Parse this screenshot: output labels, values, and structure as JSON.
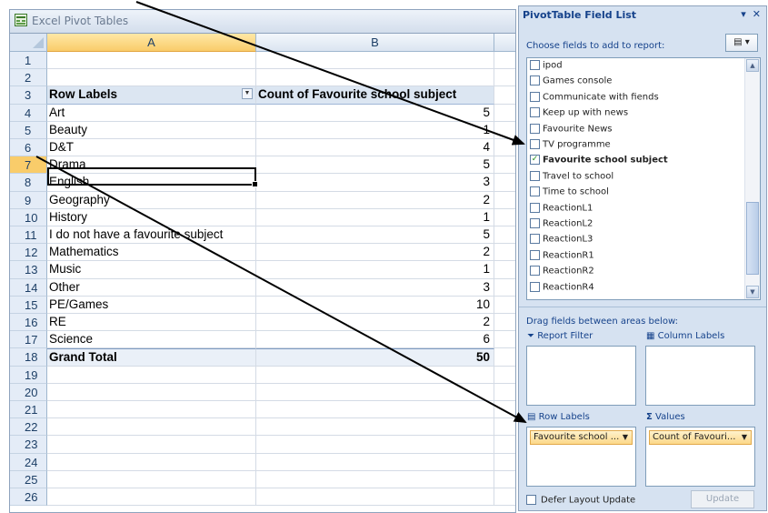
{
  "window": {
    "title": "Excel Pivot Tables",
    "icon": "excel-icon"
  },
  "columns": [
    "A",
    "B"
  ],
  "row_numbers": [
    "1",
    "2",
    "3",
    "4",
    "5",
    "6",
    "7",
    "8",
    "9",
    "10",
    "11",
    "12",
    "13",
    "14",
    "15",
    "16",
    "17",
    "18",
    "19",
    "20",
    "21",
    "22",
    "23",
    "24",
    "25",
    "26"
  ],
  "pivot": {
    "row_labels_header": "Row Labels",
    "values_header": "Count of Favourite school subject",
    "rows": [
      {
        "label": "Art",
        "count": "5"
      },
      {
        "label": "Beauty",
        "count": "1"
      },
      {
        "label": "D&T",
        "count": "4"
      },
      {
        "label": "Drama",
        "count": "5"
      },
      {
        "label": "English",
        "count": "3"
      },
      {
        "label": "Geography",
        "count": "2"
      },
      {
        "label": "History",
        "count": "1"
      },
      {
        "label": "I do not have a favourite subject",
        "count": "5"
      },
      {
        "label": "Mathematics",
        "count": "2"
      },
      {
        "label": "Music",
        "count": "1"
      },
      {
        "label": "Other",
        "count": "3"
      },
      {
        "label": "PE/Games",
        "count": "10"
      },
      {
        "label": "RE",
        "count": "2"
      },
      {
        "label": "Science",
        "count": "6"
      }
    ],
    "grand_total_label": "Grand Total",
    "grand_total_value": "50"
  },
  "field_list": {
    "title": "PivotTable Field List",
    "choose_label": "Choose fields to add to report:",
    "fields": [
      {
        "name": "ipod",
        "checked": false
      },
      {
        "name": "Games console",
        "checked": false
      },
      {
        "name": "Communicate with fiends",
        "checked": false
      },
      {
        "name": "Keep up with news",
        "checked": false
      },
      {
        "name": "Favourite News",
        "checked": false
      },
      {
        "name": "TV programme",
        "checked": false
      },
      {
        "name": "Favourite school subject",
        "checked": true
      },
      {
        "name": "Travel to school",
        "checked": false
      },
      {
        "name": "Time to school",
        "checked": false
      },
      {
        "name": "ReactionL1",
        "checked": false
      },
      {
        "name": "ReactionL2",
        "checked": false
      },
      {
        "name": "ReactionL3",
        "checked": false
      },
      {
        "name": "ReactionR1",
        "checked": false
      },
      {
        "name": "ReactionR2",
        "checked": false
      },
      {
        "name": "ReactionR4",
        "checked": false
      }
    ],
    "drag_label": "Drag fields between areas below:",
    "report_filter_label": "Report Filter",
    "column_labels_label": "Column Labels",
    "row_labels_label": "Row Labels",
    "values_label": "Values",
    "values_symbol": "Σ",
    "row_field_pill": "Favourite school ...",
    "value_field_pill": "Count of Favouri...",
    "defer_label": "Defer Layout Update",
    "update_label": "Update"
  },
  "colors": {
    "header_bg": "#dce6f2",
    "selected_header": "#f9cc6a",
    "pane_bg": "#d6e2f1",
    "pill_bg": "#fcd889"
  }
}
